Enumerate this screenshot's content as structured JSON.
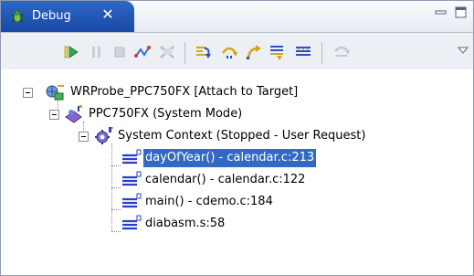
{
  "view": {
    "tab_title": "Debug",
    "close_glyph": "✕",
    "icons": {
      "tab_icon": "debug-bug-icon",
      "close": "close-icon",
      "minimize": "minimize-icon",
      "maximize": "maximize-icon",
      "menu": "view-menu-icon"
    }
  },
  "toolbar": {
    "buttons": [
      {
        "name": "resume-button",
        "icon": "resume-icon"
      },
      {
        "name": "suspend-button",
        "icon": "suspend-icon"
      },
      {
        "name": "terminate-button",
        "icon": "terminate-icon"
      },
      {
        "name": "disconnect-button",
        "icon": "disconnect-icon"
      },
      {
        "name": "remove-terminated-button",
        "icon": "remove-terminated-icon"
      },
      {
        "name": "step-into-button",
        "icon": "step-into-icon"
      },
      {
        "name": "step-over-button",
        "icon": "step-over-icon"
      },
      {
        "name": "step-return-button",
        "icon": "step-return-icon"
      },
      {
        "name": "drop-to-frame-button",
        "icon": "drop-to-frame-icon"
      },
      {
        "name": "use-step-filters-button",
        "icon": "step-filters-icon"
      },
      {
        "name": "instruction-stepping-button",
        "icon": "instruction-step-icon"
      }
    ]
  },
  "tree": {
    "root": {
      "label": "WRProbe_PPC750FX [Attach to Target]",
      "icon": "target-connection-icon"
    },
    "process": {
      "label": "PPC750FX (System Mode)",
      "icon": "process-icon"
    },
    "thread": {
      "label": "System Context (Stopped - User Request)",
      "icon": "thread-gear-icon"
    },
    "frames": [
      {
        "label": "dayOfYear() - calendar.c:213",
        "selected": true,
        "icon": "stack-frame-icon"
      },
      {
        "label": "calendar() - calendar.c:122",
        "selected": false,
        "icon": "stack-frame-icon"
      },
      {
        "label": "main() - cdemo.c:184",
        "selected": false,
        "icon": "stack-frame-icon"
      },
      {
        "label": "diabasm.s:58",
        "selected": false,
        "icon": "stack-frame-icon"
      }
    ]
  },
  "colors": {
    "tab_active": "#2356b8",
    "selection": "#316ac5",
    "frame_icon": "#2a3fc9",
    "toolbar_bg": "#eceff4"
  }
}
